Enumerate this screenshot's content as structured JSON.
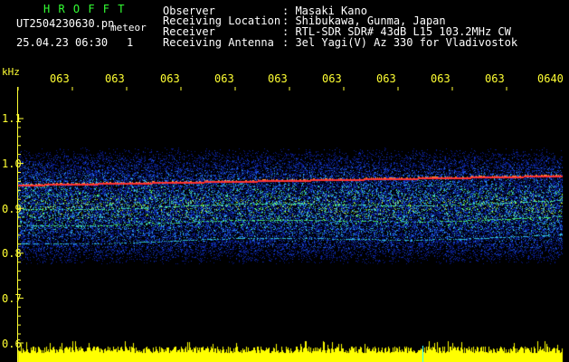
{
  "header": {
    "brand": "H R O F F T",
    "filename": "UT2504230630.pn",
    "mode": "meteor",
    "datetime": "25.04.23 06:30",
    "counter": "1",
    "fields": [
      {
        "label": "Observer",
        "value": ": Masaki Kano"
      },
      {
        "label": "Receiving Location",
        "value": ": Shibukawa, Gunma, Japan"
      },
      {
        "label": "Receiver",
        "value": ": RTL-SDR SDR# 43dB L15 103.2MHz CW"
      },
      {
        "label": "Receiving Antenna",
        "value": ": 3el Yagi(V) Az 330 for Vladivostok"
      }
    ]
  },
  "time_axis": {
    "labels": [
      "063",
      "063",
      "063",
      "063",
      "063",
      "063",
      "063",
      "063",
      "063",
      "0640"
    ]
  },
  "freq_axis": {
    "unit": "kHz",
    "labels": [
      "1.1",
      "1.0",
      "0.9",
      "0.8",
      "0.7",
      "0.6"
    ]
  },
  "colors": {
    "header_brand": "#33ff33",
    "header_text": "#ffffff",
    "axis_text": "#ffff33",
    "echo_line": "#ff3333",
    "signal_bar": "#ffff00"
  }
}
